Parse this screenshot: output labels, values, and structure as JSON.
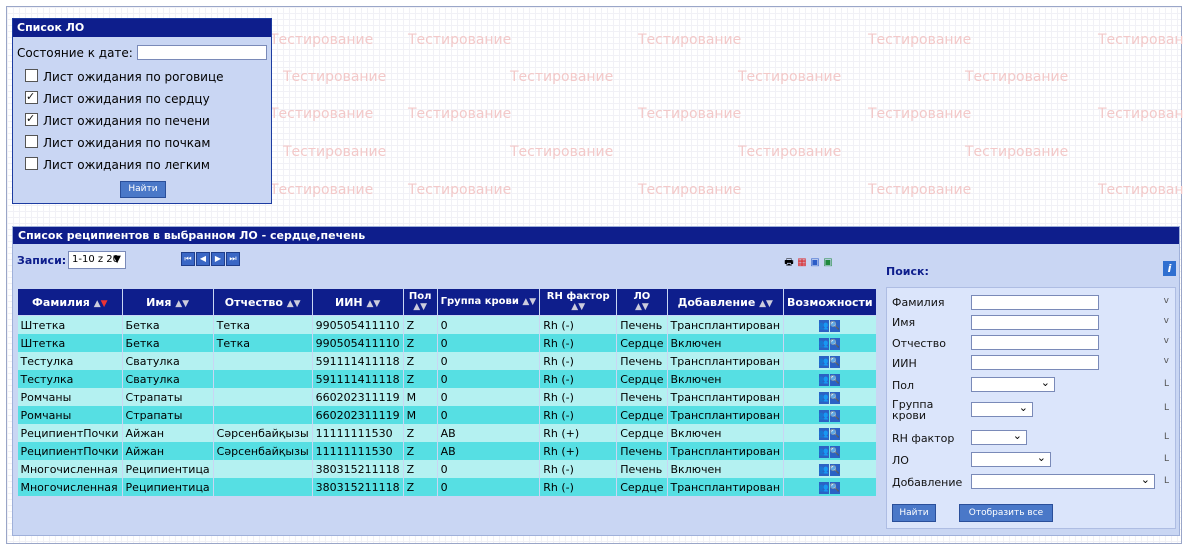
{
  "watermark": "Тестирование",
  "lo_panel": {
    "title": "Список ЛО",
    "date_label": "Состояние к дате:",
    "date_value": "",
    "options": [
      {
        "label": "Лист ожидания по роговице",
        "checked": false
      },
      {
        "label": "Лист ожидания по сердцу",
        "checked": true
      },
      {
        "label": "Лист ожидания по печени",
        "checked": true
      },
      {
        "label": "Лист ожидания по почкам",
        "checked": false
      },
      {
        "label": "Лист ожидания по легким",
        "checked": false
      }
    ],
    "find_button": "Найти"
  },
  "recipients": {
    "title": "Список реципиентов в выбранном ЛО  -  сердце,печень",
    "records_label": "Записи:",
    "records_value": "1-10 z 20",
    "columns": [
      "Фамилия",
      "Имя",
      "Отчество",
      "ИИН",
      "Пол",
      "Группа крови",
      "RH фактор",
      "ЛО",
      "Добавление",
      "Возможности"
    ],
    "rows": [
      [
        "Штетка",
        "Бетка",
        "Тетка",
        "990505411110",
        "Z",
        "0",
        "Rh (-)",
        "Печень",
        "Трансплантирован"
      ],
      [
        "Штетка",
        "Бетка",
        "Тетка",
        "990505411110",
        "Z",
        "0",
        "Rh (-)",
        "Сердце",
        "Включен"
      ],
      [
        "Тестулка",
        "Сватулка",
        "",
        "591111411118",
        "Z",
        "0",
        "Rh (-)",
        "Печень",
        "Трансплантирован"
      ],
      [
        "Тестулка",
        "Сватулка",
        "",
        "591111411118",
        "Z",
        "0",
        "Rh (-)",
        "Сердце",
        "Включен"
      ],
      [
        "Ромчаны",
        "Страпаты",
        "",
        "660202311119",
        "M",
        "0",
        "Rh (-)",
        "Печень",
        "Трансплантирован"
      ],
      [
        "Ромчаны",
        "Страпаты",
        "",
        "660202311119",
        "M",
        "0",
        "Rh (-)",
        "Сердце",
        "Трансплантирован"
      ],
      [
        "РеципиентПочки",
        "Айжан",
        "Сәрсенбайқызы",
        "11111111530",
        "Z",
        "AB",
        "Rh (+)",
        "Сердце",
        "Включен"
      ],
      [
        "РеципиентПочки",
        "Айжан",
        "Сәрсенбайқызы",
        "11111111530",
        "Z",
        "AB",
        "Rh (+)",
        "Печень",
        "Трансплантирован"
      ],
      [
        "Многочисленная",
        "Реципиентица",
        "",
        "380315211118",
        "Z",
        "0",
        "Rh (-)",
        "Печень",
        "Включен"
      ],
      [
        "Многочисленная",
        "Реципиентица",
        "",
        "380315211118",
        "Z",
        "0",
        "Rh (-)",
        "Сердце",
        "Трансплантирован"
      ]
    ]
  },
  "search": {
    "title": "Поиск:",
    "fields": {
      "surname": "Фамилия",
      "name": "Имя",
      "patronymic": "Отчество",
      "iin": "ИИН",
      "sex": "Пол",
      "blood_group": "Группа крови",
      "rh": "RH фактор",
      "lo": "ЛО",
      "added": "Добавление"
    },
    "find_button": "Найти",
    "show_all_button": "Отобразить все"
  }
}
